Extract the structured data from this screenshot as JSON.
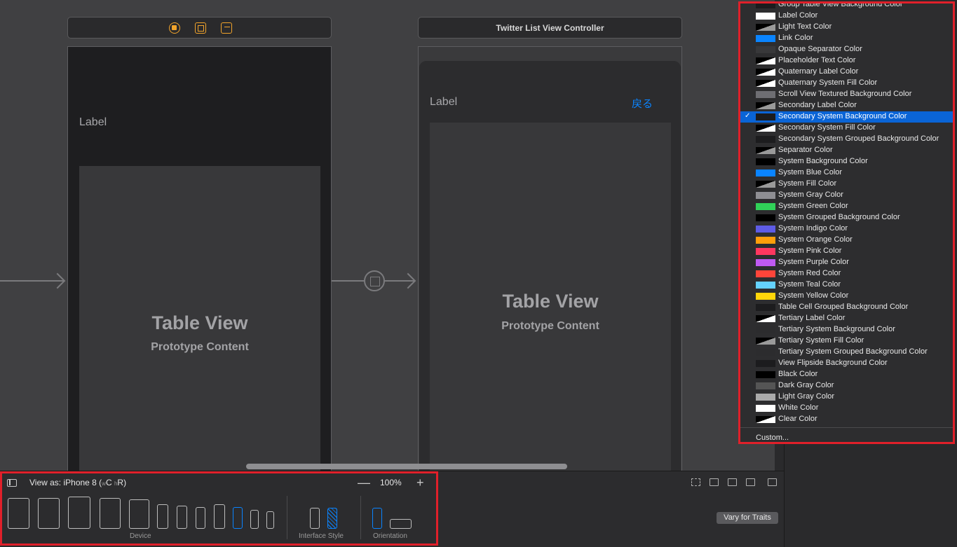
{
  "canvas": {
    "scene1": {
      "label": "Label",
      "table_title": "Table View",
      "table_subtitle": "Prototype Content"
    },
    "scene2": {
      "title": "Twitter List View Controller",
      "label": "Label",
      "back_link": "戻る",
      "table_title": "Table View",
      "table_subtitle": "Prototype Content"
    }
  },
  "color_menu": {
    "selected": "Secondary System Background Color",
    "items": [
      {
        "name": "Group Table View Background Color",
        "color": "#1c1c1e",
        "style": "solid"
      },
      {
        "name": "Label Color",
        "color": "#ffffff",
        "style": "solid"
      },
      {
        "name": "Light Text Color",
        "color": "#bbbbbb",
        "style": "tri-gray"
      },
      {
        "name": "Link Color",
        "color": "#0a84ff",
        "style": "solid"
      },
      {
        "name": "Opaque Separator Color",
        "color": "#38383a",
        "style": "solid"
      },
      {
        "name": "Placeholder Text Color",
        "color": "#8e8e93",
        "style": "tri"
      },
      {
        "name": "Quaternary Label Color",
        "color": "#ffffff",
        "style": "tri"
      },
      {
        "name": "Quaternary System Fill Color",
        "color": "#ffffff",
        "style": "tri"
      },
      {
        "name": "Scroll View Textured Background Color",
        "color": "#6e6e73",
        "style": "solid"
      },
      {
        "name": "Secondary Label Color",
        "color": "#ffffff",
        "style": "tri-gray"
      },
      {
        "name": "Secondary System Background Color",
        "color": "#1c1c1e",
        "style": "solid"
      },
      {
        "name": "Secondary System Fill Color",
        "color": "#ffffff",
        "style": "tri"
      },
      {
        "name": "Secondary System Grouped Background Color",
        "color": "#1c1c1e",
        "style": "solid"
      },
      {
        "name": "Separator Color",
        "color": "#8e8e93",
        "style": "tri-gray"
      },
      {
        "name": "System Background Color",
        "color": "#000000",
        "style": "solid"
      },
      {
        "name": "System Blue Color",
        "color": "#0a84ff",
        "style": "solid"
      },
      {
        "name": "System Fill Color",
        "color": "#ffffff",
        "style": "tri-gray"
      },
      {
        "name": "System Gray Color",
        "color": "#8e8e93",
        "style": "solid"
      },
      {
        "name": "System Green Color",
        "color": "#30d158",
        "style": "solid"
      },
      {
        "name": "System Grouped Background Color",
        "color": "#000000",
        "style": "solid"
      },
      {
        "name": "System Indigo Color",
        "color": "#5e5ce6",
        "style": "solid"
      },
      {
        "name": "System Orange Color",
        "color": "#ff9f0a",
        "style": "solid"
      },
      {
        "name": "System Pink Color",
        "color": "#ff375f",
        "style": "solid"
      },
      {
        "name": "System Purple Color",
        "color": "#bf5af2",
        "style": "solid"
      },
      {
        "name": "System Red Color",
        "color": "#ff453a",
        "style": "solid"
      },
      {
        "name": "System Teal Color",
        "color": "#64d2ff",
        "style": "solid"
      },
      {
        "name": "System Yellow Color",
        "color": "#ffd60a",
        "style": "solid"
      },
      {
        "name": "Table Cell Grouped Background Color",
        "color": "#1c1c1e",
        "style": "solid"
      },
      {
        "name": "Tertiary Label Color",
        "color": "#ffffff",
        "style": "tri"
      },
      {
        "name": "Tertiary System Background Color",
        "color": "#2c2c2e",
        "style": "solid"
      },
      {
        "name": "Tertiary System Fill Color",
        "color": "#ffffff",
        "style": "tri-gray"
      },
      {
        "name": "Tertiary System Grouped Background Color",
        "color": "#2c2c2e",
        "style": "solid"
      },
      {
        "name": "View Flipside Background Color",
        "color": "#1c1c1e",
        "style": "solid"
      },
      {
        "name": "Black Color",
        "color": "#000000",
        "style": "solid"
      },
      {
        "name": "Dark Gray Color",
        "color": "#555555",
        "style": "solid"
      },
      {
        "name": "Light Gray Color",
        "color": "#aaaaaa",
        "style": "solid"
      },
      {
        "name": "White Color",
        "color": "#ffffff",
        "style": "solid"
      },
      {
        "name": "Clear Color",
        "color": "#ffffff",
        "style": "tri"
      }
    ],
    "custom_label": "Custom..."
  },
  "toolbar": {
    "view_as_prefix": "View as: iPhone 8 (",
    "w_sub": "w",
    "w_val": "C",
    "h_sub": "h",
    "h_val": "R)",
    "zoom_minus": "—",
    "zoom_value": "100%",
    "zoom_plus": "+",
    "device_label": "Device",
    "interface_style_label": "Interface Style",
    "orientation_label": "Orientation",
    "vary_button": "Vary for Traits"
  }
}
